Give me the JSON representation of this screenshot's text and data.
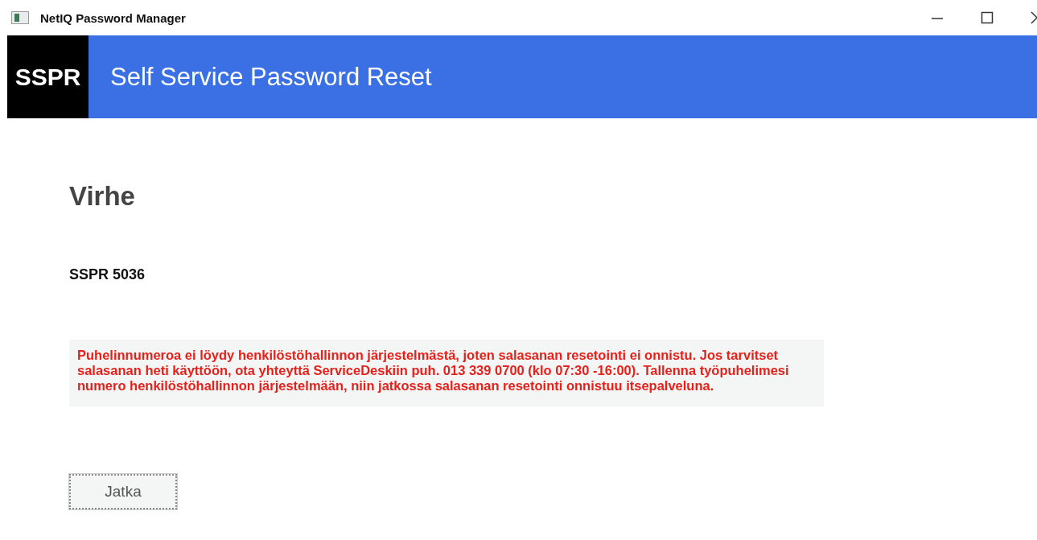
{
  "window": {
    "title": "NetIQ Password Manager"
  },
  "header": {
    "logo": "SSPR",
    "title": "Self Service Password Reset"
  },
  "page": {
    "heading": "Virhe",
    "error_code": "SSPR 5036",
    "message": "Puhelinnumeroa ei löydy henkilöstöhallinnon järjestelmästä, joten salasanan resetointi ei onnistu. Jos tarvitset salasanan heti käyttöön, ota yhteyttä ServiceDeskiin puh. 013 339 0700 (klo 07:30 -16:00). Tallenna työpuhelimesi numero henkilöstöhallinnon järjestelmään, niin jatkossa salasanan resetointi onnistuu itsepalveluna.",
    "button": "Jatka"
  }
}
